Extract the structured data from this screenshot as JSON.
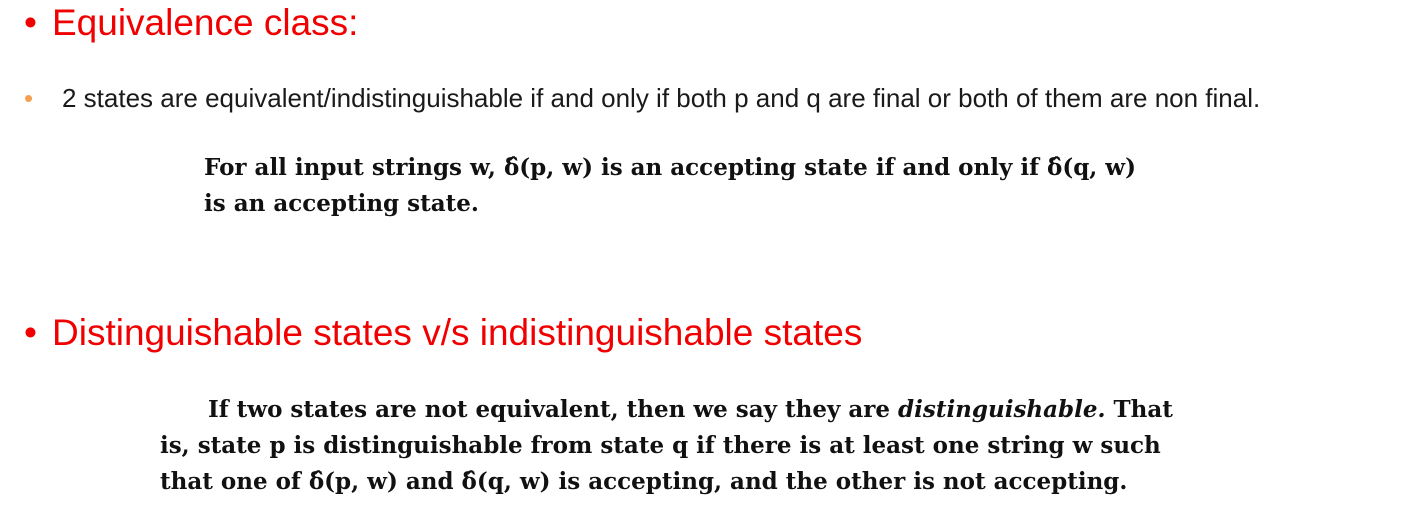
{
  "heading1": {
    "bullet": "•",
    "text": "Equivalence class:"
  },
  "sub_bullet": {
    "bullet": "•",
    "text": "2 states are equivalent/indistinguishable if and only if both p and q are final or both of them are non final."
  },
  "quote1": {
    "line1": "For all input strings w, δ̂(p, w) is an accepting state if and only if δ̂(q, w)",
    "line2": "is an accepting state."
  },
  "heading2": {
    "bullet": "•",
    "text": "Distinguishable states v/s indistinguishable states"
  },
  "quote2": {
    "line1_a": "If two states are not equivalent, then we say they are ",
    "line1_em": "distinguishable.",
    "line1_b": " That",
    "line2": "is, state p is distinguishable from state q if there is at least one string w such",
    "line3": "that one of δ̂(p, w) and δ̂(q, w) is accepting, and the other is not accepting."
  },
  "colors": {
    "heading": "#f00000",
    "sub_bullet": "#f5a050"
  }
}
